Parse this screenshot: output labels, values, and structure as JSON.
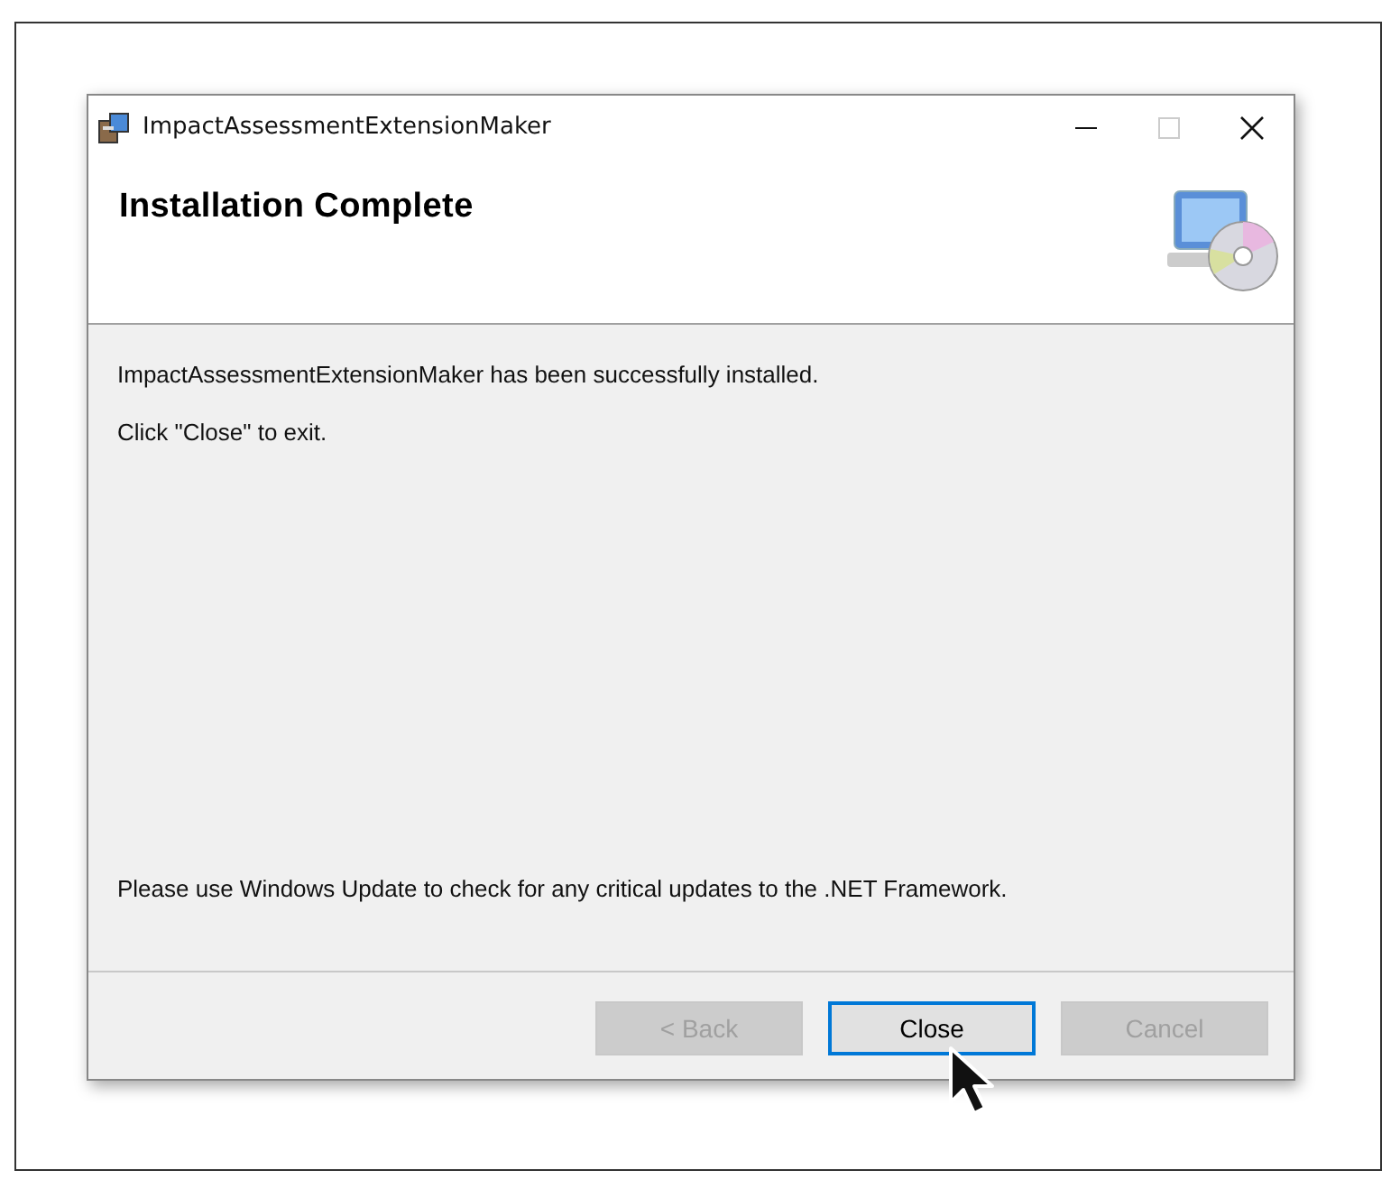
{
  "window": {
    "title": "ImpactAssessmentExtensionMaker",
    "maximize_disabled": true
  },
  "header": {
    "title": "Installation Complete"
  },
  "body": {
    "messages": [
      "ImpactAssessmentExtensionMaker has been successfully installed.",
      "Click \"Close\" to exit."
    ],
    "note": "Please use Windows Update to check for any critical updates to the .NET Framework."
  },
  "buttons": [
    {
      "label": "< Back",
      "disabled": true,
      "focused": false
    },
    {
      "label": "Close",
      "disabled": false,
      "focused": true
    },
    {
      "label": "Cancel",
      "disabled": true,
      "focused": false
    }
  ]
}
